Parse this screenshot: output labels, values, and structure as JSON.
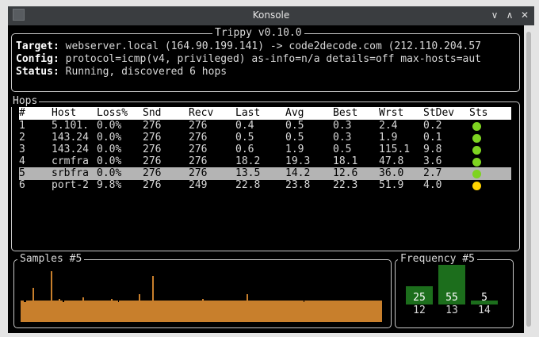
{
  "window": {
    "title": "Konsole"
  },
  "info": {
    "frame_title": "Trippy v0.10.0",
    "target_key": "Target:",
    "target_value": " webserver.local (164.90.199.141) -> code2decode.com (212.110.204.57",
    "config_key": "Config:",
    "config_value": " protocol=icmp(v4, privileged) as-info=n/a details=off max-hosts=aut",
    "status_key": "Status:",
    "status_value": " Running, discovered 6 hops"
  },
  "hops": {
    "frame_title": "Hops",
    "columns": [
      "#",
      "Host",
      "Loss%",
      "Snd",
      "Recv",
      "Last",
      "Avg",
      "Best",
      "Wrst",
      "StDev",
      "Sts"
    ],
    "selected_index": 4,
    "rows": [
      {
        "num": "1",
        "host": "5.101.",
        "loss": "0.0%",
        "snd": "276",
        "recv": "276",
        "last": "0.4",
        "avg": "0.5",
        "best": "0.3",
        "wrst": "2.4",
        "stdev": "0.2",
        "status": "green"
      },
      {
        "num": "2",
        "host": "143.24",
        "loss": "0.0%",
        "snd": "276",
        "recv": "276",
        "last": "0.5",
        "avg": "0.5",
        "best": "0.3",
        "wrst": "1.9",
        "stdev": "0.1",
        "status": "green"
      },
      {
        "num": "3",
        "host": "143.24",
        "loss": "0.0%",
        "snd": "276",
        "recv": "276",
        "last": "0.6",
        "avg": "1.9",
        "best": "0.5",
        "wrst": "115.1",
        "stdev": "9.8",
        "status": "green"
      },
      {
        "num": "4",
        "host": "crmfra",
        "loss": "0.0%",
        "snd": "276",
        "recv": "276",
        "last": "18.2",
        "avg": "19.3",
        "best": "18.1",
        "wrst": "47.8",
        "stdev": "3.6",
        "status": "green"
      },
      {
        "num": "5",
        "host": "srbfra",
        "loss": "0.0%",
        "snd": "276",
        "recv": "276",
        "last": "13.5",
        "avg": "14.2",
        "best": "12.6",
        "wrst": "36.0",
        "stdev": "2.7",
        "status": "green"
      },
      {
        "num": "6",
        "host": "port-2",
        "loss": "9.8%",
        "snd": "276",
        "recv": "249",
        "last": "22.8",
        "avg": "23.8",
        "best": "22.3",
        "wrst": "51.9",
        "stdev": "4.0",
        "status": "yellow"
      }
    ]
  },
  "samples": {
    "frame_title": "Samples #5",
    "values": [
      14,
      14,
      13,
      13,
      14,
      14,
      14,
      14,
      14,
      22,
      14,
      14,
      14,
      14,
      14,
      14,
      14,
      14,
      14,
      14,
      14,
      14,
      14,
      33,
      14,
      14,
      14,
      14,
      14,
      15,
      14,
      14,
      13,
      14,
      14,
      14,
      14,
      14,
      14,
      14,
      14,
      14,
      14,
      14,
      14,
      14,
      14,
      16,
      14,
      14,
      14,
      14,
      14,
      14,
      14,
      14,
      14,
      14,
      14,
      14,
      14,
      14,
      14,
      14,
      14,
      14,
      14,
      14,
      14,
      15,
      14,
      14,
      14,
      14,
      13,
      14,
      14,
      14,
      14,
      14,
      14,
      14,
      14,
      14,
      14,
      14,
      14,
      14,
      14,
      14,
      18,
      14,
      14,
      14,
      14,
      14,
      14,
      14,
      14,
      14,
      30,
      14,
      14,
      14,
      14,
      14,
      14,
      14,
      14,
      14,
      14,
      14,
      14,
      14,
      14,
      14,
      14,
      14,
      14,
      14,
      14,
      14,
      14,
      14,
      14,
      14,
      14,
      14,
      14,
      14,
      14,
      14,
      14,
      14,
      14,
      14,
      14,
      14,
      15,
      14,
      14,
      14,
      14,
      14,
      14,
      14,
      14,
      14,
      14,
      14,
      14,
      14,
      14,
      14,
      14,
      14,
      14,
      14,
      14,
      14,
      14,
      14,
      14,
      14,
      14,
      14,
      14,
      14,
      14,
      14,
      14,
      14,
      18,
      14,
      14,
      14,
      14,
      14,
      14,
      14,
      14,
      14,
      14,
      14,
      14,
      14,
      14,
      14,
      14,
      14,
      14,
      14,
      14,
      14,
      14,
      14,
      14,
      14,
      14,
      14,
      14,
      14,
      14,
      14,
      14,
      14,
      14,
      14,
      14,
      14,
      14,
      14,
      14,
      14,
      14,
      13,
      14,
      14,
      14,
      14,
      14,
      14,
      14,
      14,
      14,
      14,
      14,
      14,
      14,
      14,
      14,
      14,
      14,
      14,
      14,
      14,
      14,
      14,
      14,
      14,
      14,
      14,
      14,
      14,
      14,
      14,
      14,
      14,
      14,
      14,
      14,
      14,
      14,
      14,
      14,
      14,
      14,
      14,
      14,
      14,
      14,
      14,
      14,
      14,
      14,
      14,
      14,
      14,
      14,
      14,
      14,
      14,
      14,
      14,
      14
    ],
    "bar_color": "#c87f2c"
  },
  "frequency": {
    "frame_title": "Frequency #5",
    "bars": [
      {
        "label": "12",
        "value": "25",
        "count": 25
      },
      {
        "label": "13",
        "value": "55",
        "count": 55
      },
      {
        "label": "14",
        "value": "5",
        "count": 5
      }
    ],
    "bar_color": "#1c6e1c"
  },
  "colors": {
    "status_green": "#7ed321",
    "status_yellow": "#ffd400",
    "selected_row": "#b4b4b4"
  }
}
